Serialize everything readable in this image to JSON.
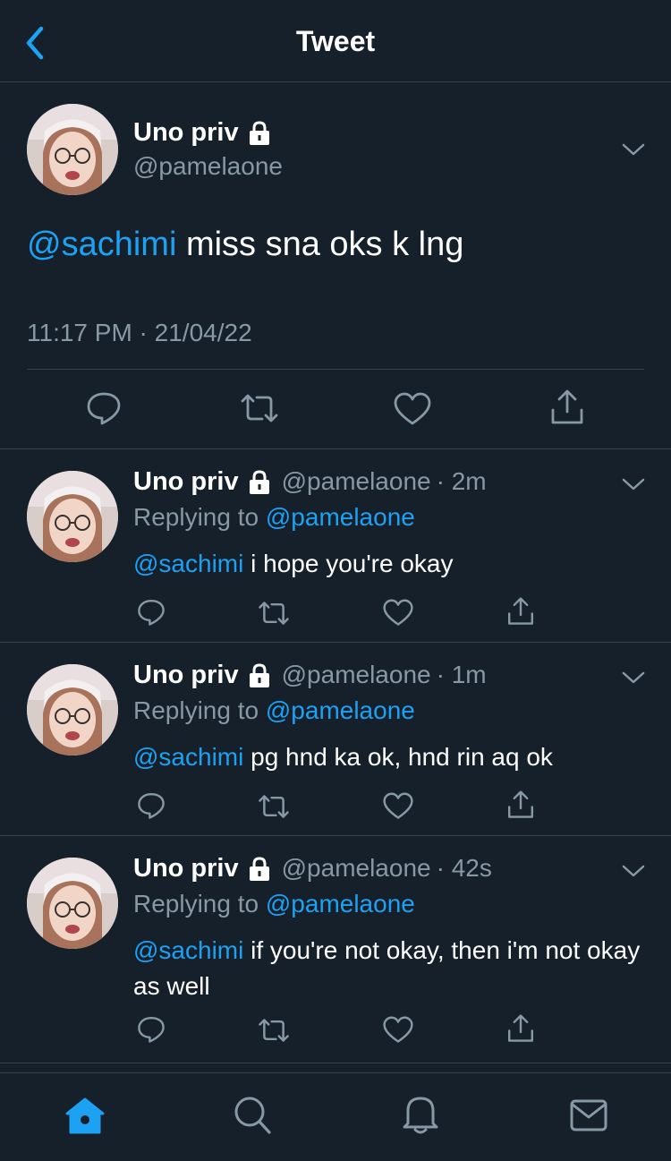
{
  "header": {
    "title": "Tweet"
  },
  "main_tweet": {
    "name": "Uno priv",
    "handle": "@pamelaone",
    "mention": "@sachimi",
    "text": " miss sna oks k lng",
    "timestamp": "11:17 PM · 21/04/22"
  },
  "replies": [
    {
      "name": "Uno priv",
      "handle": "@pamelaone",
      "time": "· 2m",
      "replying_prefix": "Replying to ",
      "replying_to": "@pamelaone",
      "mention": "@sachimi",
      "text": " i hope you're okay"
    },
    {
      "name": "Uno priv",
      "handle": "@pamelaone",
      "time": "· 1m",
      "replying_prefix": "Replying to ",
      "replying_to": "@pamelaone",
      "mention": "@sachimi",
      "text": " pg hnd ka ok, hnd rin aq ok"
    },
    {
      "name": "Uno priv",
      "handle": "@pamelaone",
      "time": "· 42s",
      "replying_prefix": "Replying to ",
      "replying_to": "@pamelaone",
      "mention": "@sachimi",
      "text": " if you're not okay, then i'm not okay as well"
    }
  ],
  "tabbar": {
    "items": [
      "home-icon",
      "search-icon",
      "notifications-icon",
      "messages-icon"
    ]
  },
  "colors": {
    "background": "#15202b",
    "accent": "#1da1f2",
    "secondary_text": "#8899a6",
    "divider": "#38444d"
  }
}
